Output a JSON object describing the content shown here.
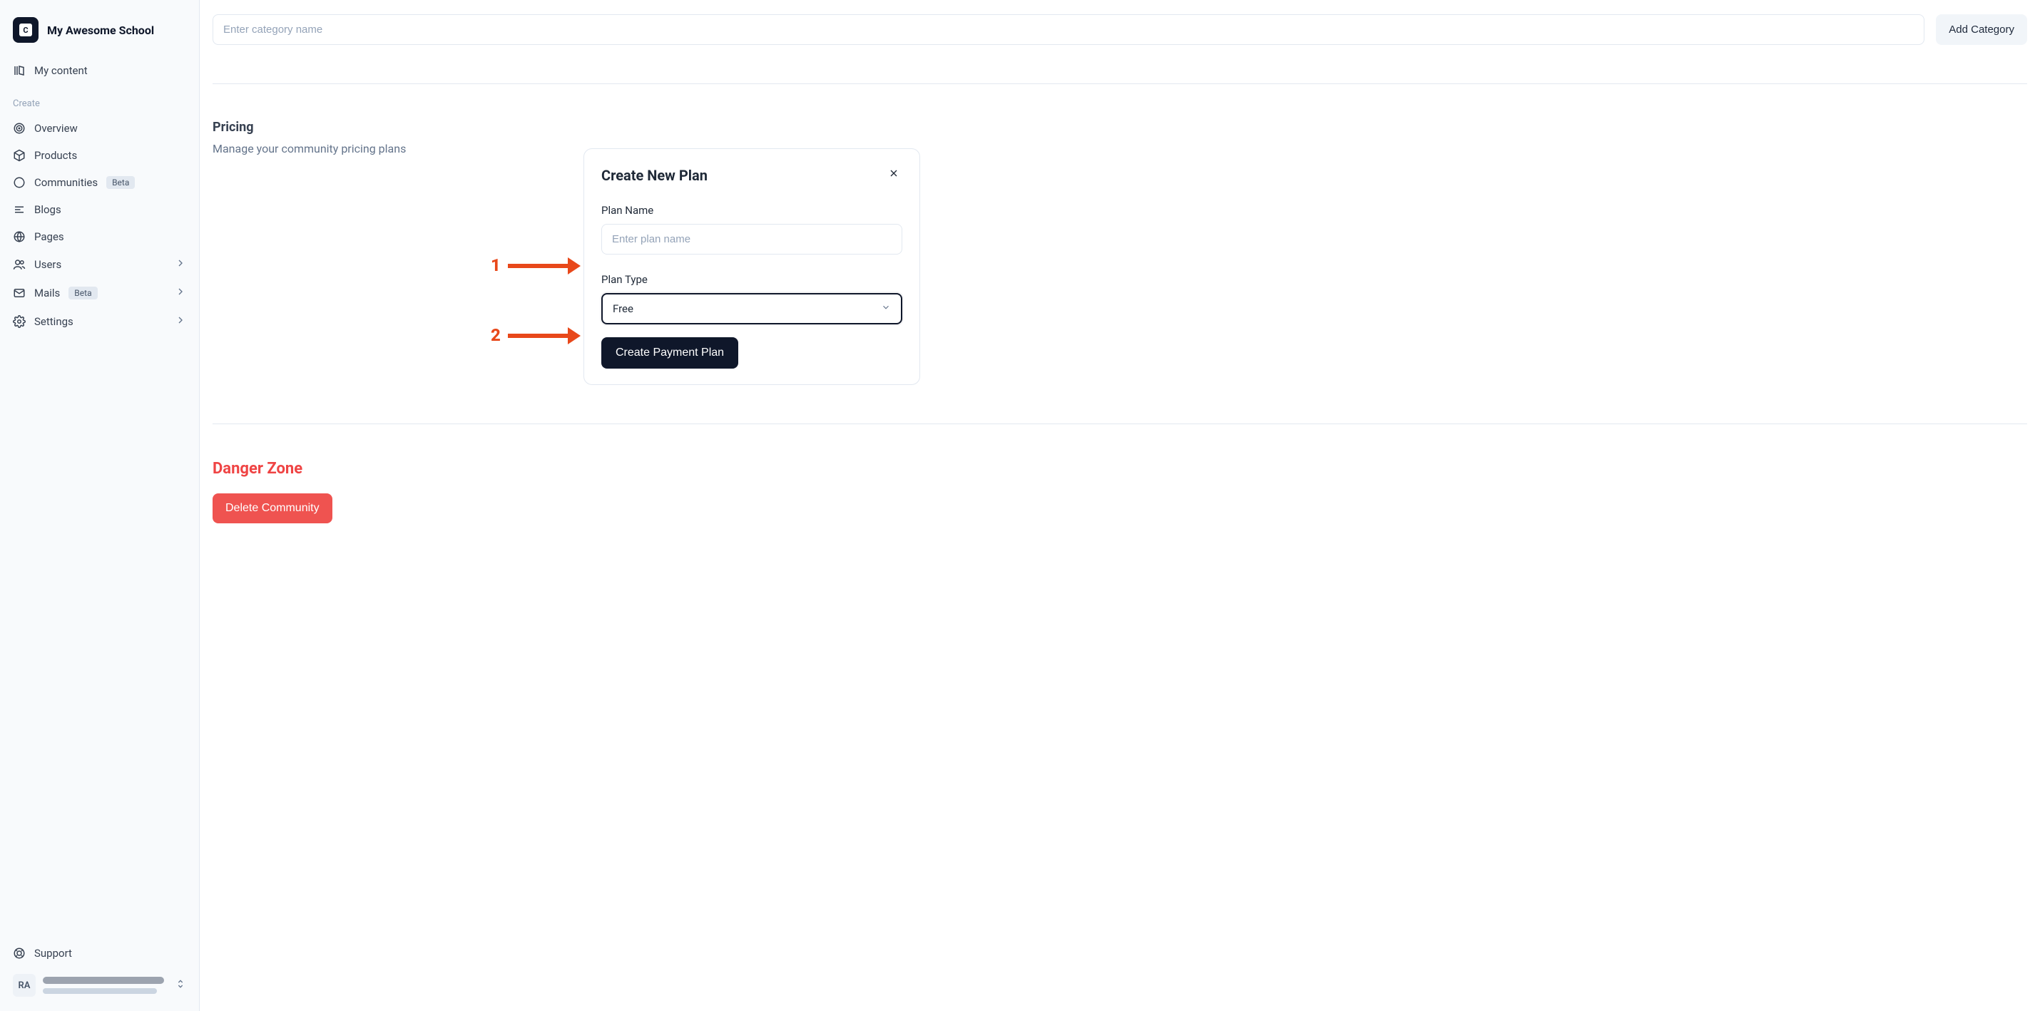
{
  "sidebar": {
    "school_name": "My Awesome School",
    "logo_letter": "C",
    "my_content_label": "My content",
    "section_label": "Create",
    "items": {
      "overview": "Overview",
      "products": "Products",
      "communities": "Communities",
      "blogs": "Blogs",
      "pages": "Pages",
      "users": "Users",
      "mails": "Mails",
      "settings": "Settings"
    },
    "badges": {
      "communities": "Beta",
      "mails": "Beta"
    },
    "support_label": "Support",
    "user_initials": "RA"
  },
  "category": {
    "placeholder": "Enter category name",
    "add_button": "Add Category"
  },
  "pricing": {
    "title": "Pricing",
    "subtitle": "Manage your community pricing plans"
  },
  "modal": {
    "title": "Create New Plan",
    "plan_name_label": "Plan Name",
    "plan_name_placeholder": "Enter plan name",
    "plan_type_label": "Plan Type",
    "plan_type_value": "Free",
    "create_button": "Create Payment Plan"
  },
  "danger": {
    "title": "Danger Zone",
    "delete_button": "Delete Community"
  },
  "annotations": {
    "a1": "1",
    "a2": "2"
  }
}
